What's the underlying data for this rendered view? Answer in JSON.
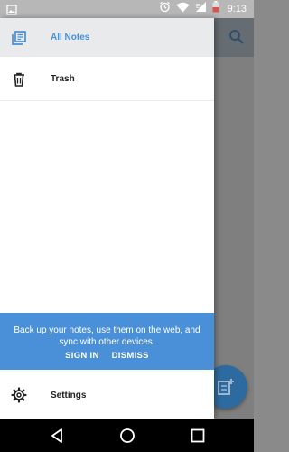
{
  "status_bar": {
    "time": "9:13",
    "icons": [
      "image-icon",
      "alarm-icon",
      "wifi-icon",
      "signal-e-icon",
      "battery-icon"
    ]
  },
  "drawer": {
    "items": [
      {
        "label": "All Notes",
        "icon": "notes-icon",
        "selected": true
      },
      {
        "label": "Trash",
        "icon": "trash-icon",
        "selected": false
      }
    ],
    "backup": {
      "message": "Back up your notes, use them on the web, and sync with other devices.",
      "sign_in": "SIGN IN",
      "dismiss": "DISMISS"
    },
    "settings": {
      "label": "Settings",
      "icon": "gear-icon"
    }
  },
  "nav_bar": {
    "buttons": [
      "back-icon",
      "home-icon",
      "recents-icon"
    ]
  },
  "colors": {
    "accent": "#4a90d9",
    "selected_text": "#4a8fd6",
    "fab": "#2d6aa0"
  }
}
